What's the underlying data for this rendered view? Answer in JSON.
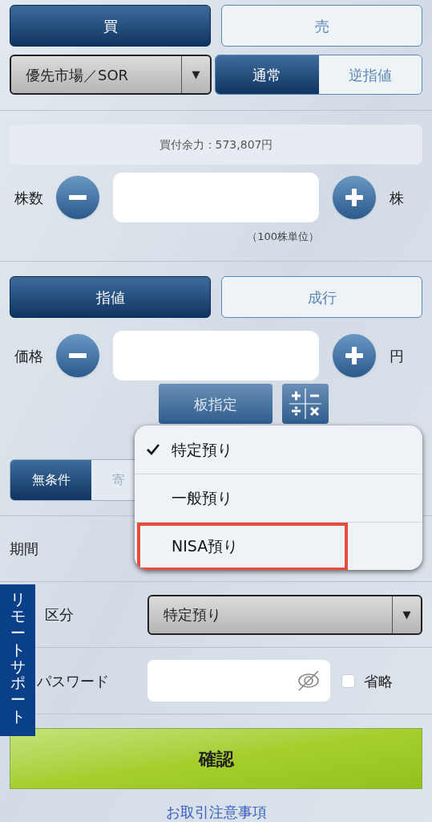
{
  "side_toggle": [
    {
      "label": "買",
      "selected": true
    },
    {
      "label": "売",
      "selected": false
    }
  ],
  "market_select": {
    "value": "優先市場／SOR",
    "arrow": "▼"
  },
  "order_kind": [
    {
      "label": "通常",
      "selected": true
    },
    {
      "label": "逆指値",
      "selected": false
    }
  ],
  "buying_power": "買付余力：573,807円",
  "quantity": {
    "label": "株数",
    "unit": "株",
    "note": "（100株単位）"
  },
  "price_type": [
    {
      "label": "指値",
      "selected": true
    },
    {
      "label": "成行",
      "selected": false
    }
  ],
  "price": {
    "label": "価格",
    "unit": "円"
  },
  "board_button": "板指定",
  "condition": [
    {
      "label": "無条件",
      "selected": true
    },
    {
      "label": "寄",
      "selected": false
    }
  ],
  "period": {
    "label": "期間"
  },
  "account": {
    "label": "区分",
    "value": "特定預り",
    "arrow": "▼"
  },
  "password": {
    "label": "パスワード",
    "skip_label": "省略",
    "skip_checked": false
  },
  "confirm_button": "確認",
  "notice_link": "お取引注意事項",
  "account_menu": {
    "items": [
      {
        "label": "特定預り",
        "selected": true,
        "highlighted": false
      },
      {
        "label": "一般預り",
        "selected": false,
        "highlighted": false
      },
      {
        "label": "NISA預り",
        "selected": false,
        "highlighted": true
      }
    ]
  },
  "remote_support": "リモートサポート"
}
